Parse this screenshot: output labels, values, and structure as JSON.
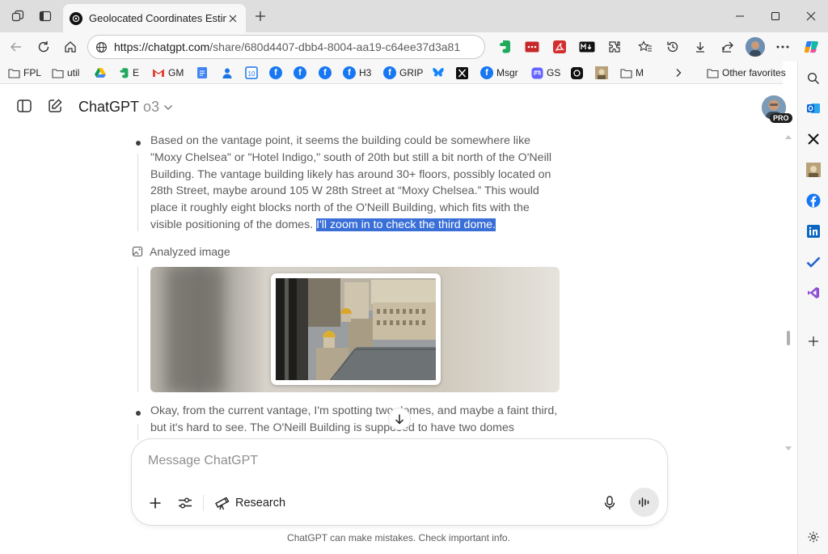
{
  "browser": {
    "tab_title": "Geolocated Coordinates Estimate",
    "url_host": "https://chatgpt.com",
    "url_path": "/share/680d4407-dbb4-8004-aa19-c64ee37d3a81"
  },
  "favorites": {
    "items": [
      "FPL",
      "util",
      "E",
      "GM",
      "H3",
      "GRIP",
      "Msgr",
      "GS",
      "M"
    ],
    "other": "Other favorites"
  },
  "chatgpt": {
    "title": "ChatGPT",
    "model": "o3",
    "pro_badge": "PRO"
  },
  "conversation": {
    "para1_text": "Based on the vantage point, it seems the building could be somewhere like \"Moxy Chelsea\" or \"Hotel Indigo,\" south of 20th but still a bit north of the O'Neill Building. The vantage building likely has around 30+ floors, possibly located on 28th Street, maybe around 105 W 28th Street at “Moxy Chelsea.” This would place it roughly eight blocks north of the O'Neill Building, which fits with the visible positioning of the domes.",
    "para1_highlight": "I'll zoom in to check the third dome.",
    "analyzed_label": "Analyzed image",
    "para2_text": "Okay, from the current vantage, I'm spotting two domes, and maybe a faint third, but it's hard to see. The O'Neill Building is supposed to have two domes"
  },
  "composer": {
    "placeholder": "Message ChatGPT",
    "research_label": "Research"
  },
  "footer": {
    "disclaimer": "ChatGPT can make mistakes. Check important info."
  },
  "colors": {
    "highlight": "#3a6fd8",
    "chrome": "#dedede"
  }
}
